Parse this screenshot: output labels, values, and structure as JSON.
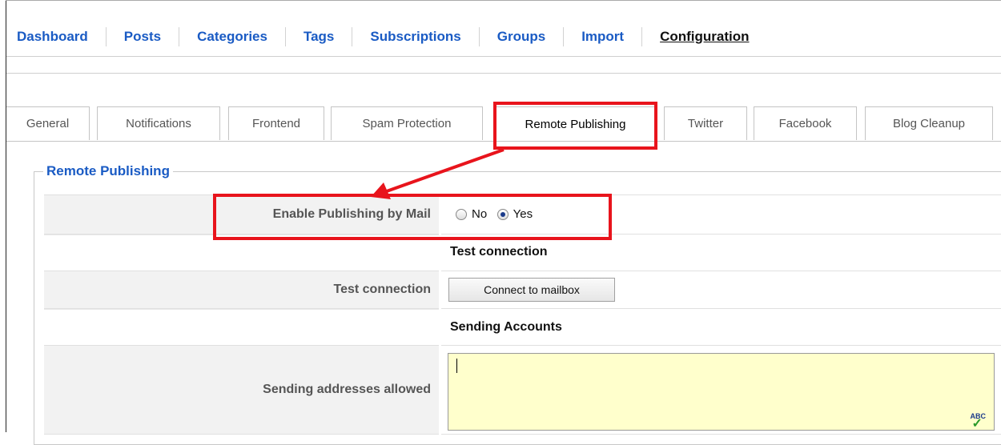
{
  "topnav": [
    "Dashboard",
    "Posts",
    "Categories",
    "Tags",
    "Subscriptions",
    "Groups",
    "Import",
    "Configuration"
  ],
  "subtabs": [
    "General",
    "Notifications",
    "Frontend",
    "Spam Protection",
    "Remote Publishing",
    "Twitter",
    "Facebook",
    "Blog Cleanup"
  ],
  "active_subtab": "Remote Publishing",
  "section": {
    "legend": "Remote Publishing",
    "enable_label": "Enable Publishing by Mail",
    "radio_no": "No",
    "radio_yes": "Yes",
    "selected": "Yes",
    "test_heading": "Test connection",
    "test_label": "Test connection",
    "connect_button": "Connect to mailbox",
    "sending_heading": "Sending Accounts",
    "sending_label": "Sending addresses allowed",
    "sending_value": "",
    "spellcheck": "ABC"
  },
  "annotation_color": "#e8141c"
}
